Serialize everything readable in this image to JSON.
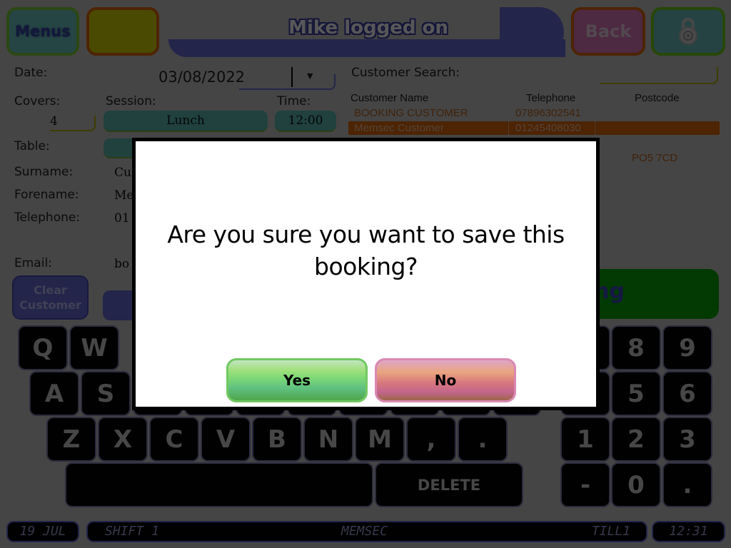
{
  "header": {
    "menus_label": "Menus",
    "title": "Mike logged on",
    "back_label": "Back",
    "lock_icon": "padlock-icon"
  },
  "booking_form": {
    "date_label": "Date:",
    "date_value": "03/08/2022",
    "covers_label": "Covers:",
    "covers_value": "4",
    "session_label": "Session:",
    "session_value": "Lunch",
    "time_label": "Time:",
    "time_value": "12:00",
    "table_label": "Table:",
    "surname_label": "Surname:",
    "surname_value": "Cu",
    "forename_label": "Forename:",
    "forename_value": "Me",
    "telephone_label": "Telephone:",
    "telephone_value": "01",
    "email_label": "Email:",
    "email_value": "bo",
    "clear_customer_label": "Clear Customer",
    "save_booking_partial": "ng"
  },
  "customer_search": {
    "label": "Customer Search:",
    "value": "",
    "columns": [
      "Customer Name",
      "Telephone",
      "Postcode"
    ],
    "rows": [
      {
        "name": "BOOKING CUSTOMER",
        "telephone": "07896302541",
        "postcode": ""
      },
      {
        "name": "Memsec Customer",
        "telephone": "01245408030",
        "postcode": "",
        "selected": true
      },
      {
        "name": "",
        "telephone": "",
        "postcode": "PO5 7CD"
      }
    ]
  },
  "keyboard": {
    "row1": [
      "Q",
      "W"
    ],
    "row2": [
      "A",
      "S"
    ],
    "row3": [
      "Z",
      "X",
      "C",
      "V",
      "B",
      "N",
      "M",
      ",",
      "."
    ],
    "delete_label": "DELETE",
    "numpad": [
      "8",
      "9",
      "5",
      "6",
      "1",
      "2",
      "3",
      "-",
      "0",
      "."
    ]
  },
  "status_bar": {
    "date": "19 JUL",
    "shift": "SHIFT 1",
    "company": "MEMSEC",
    "till": "TILL1",
    "time": "12:31"
  },
  "dialog": {
    "message": "Are you sure you want to save this booking?",
    "yes_label": "Yes",
    "no_label": "No"
  }
}
